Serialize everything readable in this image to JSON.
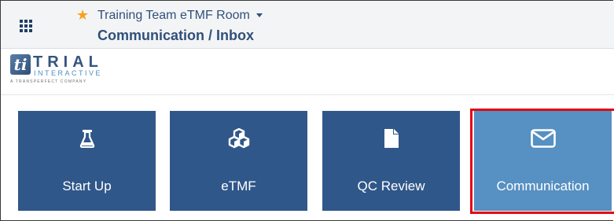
{
  "header": {
    "favorite_icon": "star-icon",
    "room_title": "Training Team eTMF Room",
    "page_title": "Communication / Inbox"
  },
  "logo": {
    "line1": "TRIAL",
    "line2": "INTERACTIVE",
    "line3": "A TRANSPERFECT COMPANY"
  },
  "tiles": [
    {
      "label": "Start Up",
      "icon": "flask-icon"
    },
    {
      "label": "eTMF",
      "icon": "cubes-icon"
    },
    {
      "label": "QC Review",
      "icon": "document-icon"
    },
    {
      "label": "Communication",
      "icon": "envelope-icon",
      "selected": true
    }
  ],
  "colors": {
    "tile": "#30578a",
    "tile_active": "#5790c2",
    "highlight": "#e30613",
    "star": "#f7a21b",
    "header_text": "#30507a"
  }
}
